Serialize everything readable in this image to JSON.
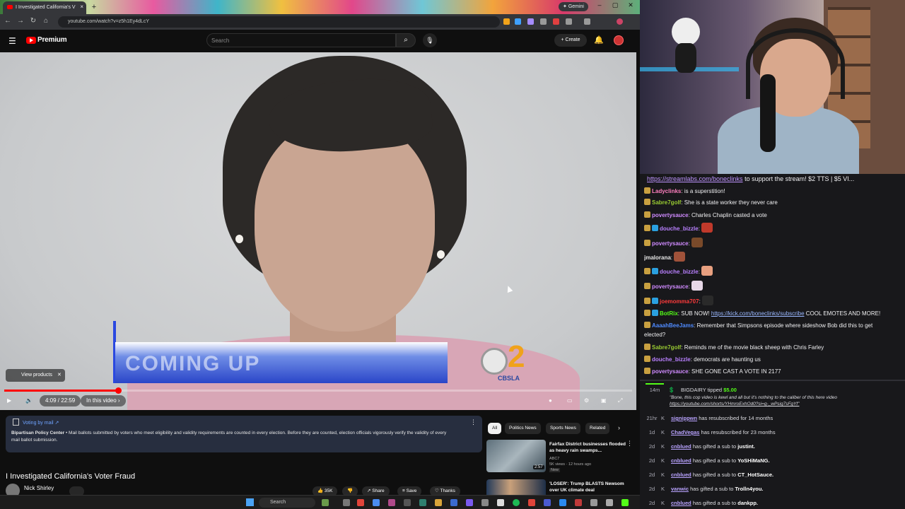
{
  "browser": {
    "tab_title": "I Investigated California's V",
    "gemini_label": "Gemini",
    "url": "youtube.com/watch?v=z5h1Ey4dLcY"
  },
  "youtube": {
    "logo_label": "Premium",
    "search_placeholder": "Search",
    "create_label": "Create"
  },
  "player": {
    "lower_third_text": "COMING UP",
    "station_number": "2",
    "station_label": "CBSLA",
    "view_products_label": "View products",
    "time_label": "4:09 / 22:59",
    "chapter_label": "In this video",
    "progress_fraction": 0.181
  },
  "notice": {
    "title": "Voting by mail",
    "source": "Bipartisan Policy Center",
    "body": "Mail ballots submitted by voters who meet eligibility and validity requirements are counted in every election. Before they are counted, election officials vigorously verify the validity of every mail ballot submission."
  },
  "video_info": {
    "title": "I Investigated California's Voter Fraud",
    "channel": "Nick Shirley",
    "likes": "35K",
    "share_label": "Share",
    "save_label": "Save",
    "thanks_label": "Thanks"
  },
  "chips": [
    "All",
    "Politics News",
    "Sports News",
    "Related"
  ],
  "recommendations": [
    {
      "title": "Fairfax District businesses flooded as heavy rain swamps...",
      "channel": "ABC7",
      "meta": "5K views · 12 hours ago",
      "badge": "New",
      "duration": "2:57"
    },
    {
      "title": "'LOSER': Trump BLASTS Newsom over UK climate deal",
      "channel": "",
      "meta": "",
      "badge": "",
      "duration": ""
    }
  ],
  "taskbar": {
    "search_label": "Search"
  },
  "chat": {
    "pinned_link": "https://streamlabs.com/boneclinks",
    "pinned_text": " to support the stream! $2 TTS | $5 VI...",
    "messages": [
      {
        "user": "Ladyclinks",
        "text": "is a superstition!",
        "color": "#ff7fbf"
      },
      {
        "user": "Sabre7golf",
        "text": "She is a state worker they never care",
        "color": "#9acd32"
      },
      {
        "user": "povertysauce",
        "text": "Charles Chaplin casted a vote",
        "color": "#d08bff"
      },
      {
        "user": "douche_bizzle",
        "text": "",
        "color": "#b980ff"
      },
      {
        "user": "povertysauce",
        "text": "",
        "color": "#d08bff"
      },
      {
        "user": "jmalorana",
        "text": "",
        "color": "#e8e8e8"
      },
      {
        "user": "douche_bizzle",
        "text": "",
        "color": "#b980ff"
      },
      {
        "user": "povertysauce",
        "text": "",
        "color": "#d08bff"
      },
      {
        "user": "joemomma707",
        "text": "",
        "color": "#ff3b3b"
      },
      {
        "user": "BotRix",
        "text": "SUB NOW! ",
        "link": "https://kick.com/boneclinks/subscribe",
        "after": " COOL EMOTES AND MORE!",
        "color": "#53fc18"
      },
      {
        "user": "AaaahBeeJams",
        "text": "Remember that Simpsons episode where sideshow Bob did this to get",
        "cont": "elected?",
        "color": "#4f8bff"
      },
      {
        "user": "Sabre7golf",
        "text": "Reminds me of the movie black sheep with Chris Farley",
        "color": "#9acd32"
      },
      {
        "user": "douche_bizzle",
        "text": "democrats are haunting us",
        "color": "#b980ff"
      },
      {
        "user": "povertysauce",
        "text": "SHE GONE CAST A VOTE IN 2177",
        "color": "#d08bff"
      }
    ],
    "tip": {
      "time": "14m",
      "user": "BIGDAIRY",
      "action": "tipped",
      "amount": "$5.00",
      "message": "\"Bone, this cop video is kewl and all but it's nothing to the caliber of this here video",
      "link": "https://youtube.com/shorts/YHmroExhOd0?si=g-_wPsig7sFgYf\""
    },
    "events": [
      {
        "time": "21hr",
        "user": "signippwn",
        "text": "has resubscribed for 14 months"
      },
      {
        "time": "1d",
        "user": "ChadVegas",
        "text": "has resubscribed for 23 months"
      },
      {
        "time": "2d",
        "user": "cnblued",
        "text": "has gifted a sub to",
        "target": "justint."
      },
      {
        "time": "2d",
        "user": "cnblued",
        "text": "has gifted a sub to",
        "target": "YoSHiMaNG."
      },
      {
        "time": "2d",
        "user": "cnblued",
        "text": "has gifted a sub to",
        "target": "CT_HotSauce."
      },
      {
        "time": "2d",
        "user": "vanwic",
        "text": "has gifted a sub to",
        "target": "Trolln4you."
      },
      {
        "time": "2d",
        "user": "cnblued",
        "text": "has gifted a sub to",
        "target": "dankpp."
      }
    ]
  },
  "colors": {
    "accent_red": "#ff0000",
    "kick_green": "#53fc18",
    "notice_link": "#6fa3ff"
  }
}
